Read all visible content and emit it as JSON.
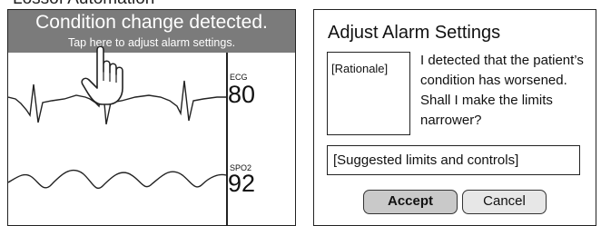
{
  "page": {
    "heading": "Lossof Automation"
  },
  "monitor": {
    "banner": {
      "title": "Condition change detected.",
      "subtitle": "Tap here to adjust alarm settings."
    },
    "ecg": {
      "label": "ECG",
      "value": "80"
    },
    "spo2": {
      "label": "SPO2",
      "value": "92"
    }
  },
  "dialog": {
    "title": "Adjust Alarm Settings",
    "rationale_placeholder": "[Rationale]",
    "message": "I detected that the patient’s condition has worsened. Shall I make the limits narrower?",
    "suggested_placeholder": "[Suggested limits and controls]",
    "accept_label": "Accept",
    "cancel_label": "Cancel"
  },
  "colors": {
    "banner_bg": "#7b7b7b",
    "accept_bg": "#c9c9c9",
    "cancel_bg": "#e7e7e7"
  },
  "icons": {
    "pointer": "hand-pointer-icon"
  }
}
